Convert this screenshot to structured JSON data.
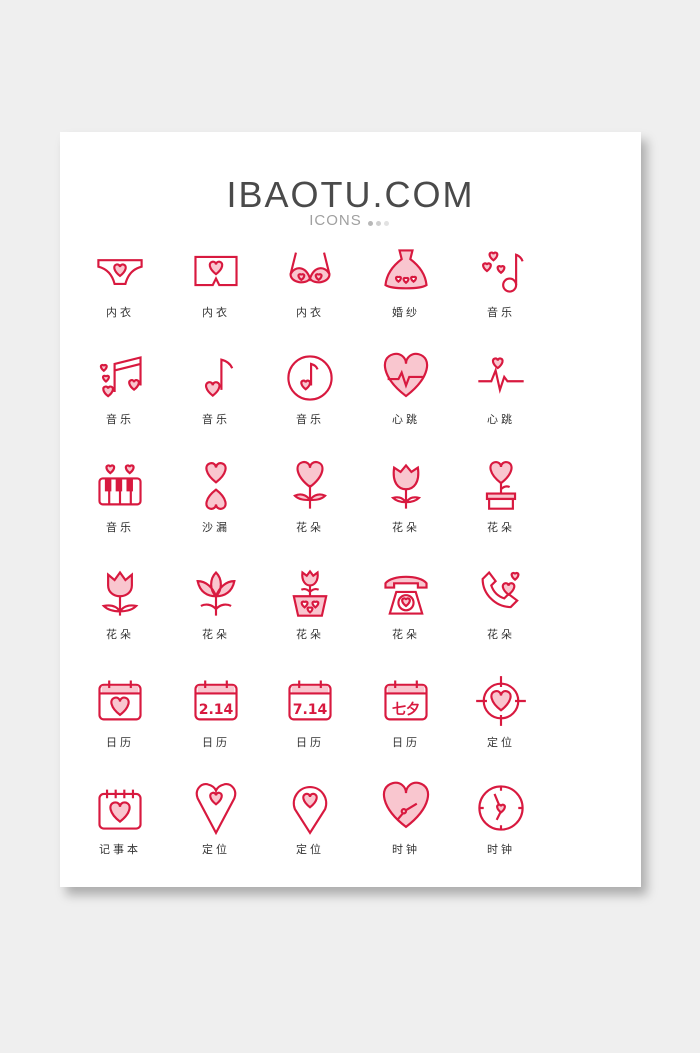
{
  "header": {
    "title": "IBAOTU.COM",
    "subtitle": "ICONS"
  },
  "colors": {
    "stroke": "#d8193f",
    "fill": "#f9c6cf",
    "dots": [
      "#b8b8b8",
      "#cfcfcf",
      "#e2e2e2"
    ]
  },
  "icons": [
    {
      "icon": "briefs-icon",
      "label": "内衣"
    },
    {
      "icon": "boxers-icon",
      "label": "内衣"
    },
    {
      "icon": "bra-icon",
      "label": "内衣"
    },
    {
      "icon": "wedding-dress-icon",
      "label": "婚纱"
    },
    {
      "icon": "music-note-hearts-icon",
      "label": "音乐"
    },
    {
      "icon": "double-music-note-icon",
      "label": "音乐"
    },
    {
      "icon": "music-note-heart-icon",
      "label": "音乐"
    },
    {
      "icon": "music-disc-icon",
      "label": "音乐"
    },
    {
      "icon": "heartbeat-heart-icon",
      "label": "心跳"
    },
    {
      "icon": "heartbeat-line-icon",
      "label": "心跳"
    },
    {
      "icon": "piano-icon",
      "label": "音乐"
    },
    {
      "icon": "hourglass-icon",
      "label": "沙漏"
    },
    {
      "icon": "heart-flower-icon",
      "label": "花朵"
    },
    {
      "icon": "rose-icon",
      "label": "花朵"
    },
    {
      "icon": "potted-heart-icon",
      "label": "花朵"
    },
    {
      "icon": "tulip-icon",
      "label": "花朵"
    },
    {
      "icon": "lotus-icon",
      "label": "花朵"
    },
    {
      "icon": "potted-rose-icon",
      "label": "花朵"
    },
    {
      "icon": "telephone-icon",
      "label": "花朵"
    },
    {
      "icon": "phone-call-icon",
      "label": "花朵"
    },
    {
      "icon": "calendar-heart-icon",
      "label": "日历"
    },
    {
      "icon": "calendar-date-icon",
      "label": "日历",
      "text": "2.14"
    },
    {
      "icon": "calendar-date-icon",
      "label": "日历",
      "text": "7.14"
    },
    {
      "icon": "calendar-date-icon",
      "label": "日历",
      "text": "七夕"
    },
    {
      "icon": "target-heart-icon",
      "label": "定位"
    },
    {
      "icon": "notebook-icon",
      "label": "记事本"
    },
    {
      "icon": "heart-pin-icon",
      "label": "定位"
    },
    {
      "icon": "location-pin-icon",
      "label": "定位"
    },
    {
      "icon": "heart-clock-icon",
      "label": "时钟"
    },
    {
      "icon": "clock-icon",
      "label": "时钟"
    }
  ]
}
